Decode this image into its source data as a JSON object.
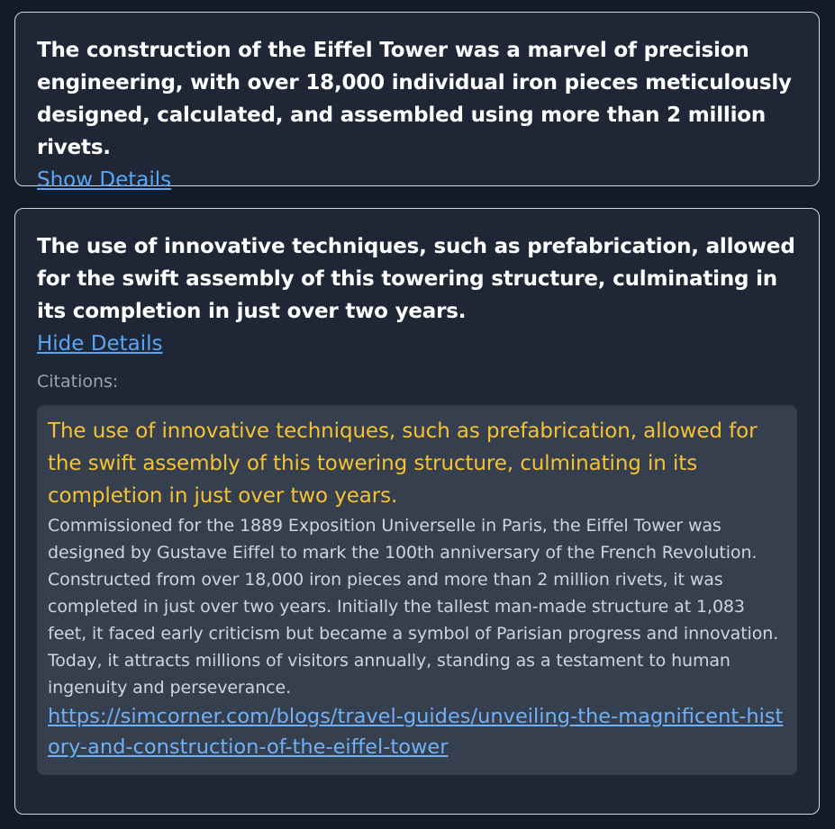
{
  "cards": [
    {
      "claim": "The construction of the Eiffel Tower was a marvel of precision engineering, with over 18,000 individual iron pieces meticulously designed, calculated, and assembled using more than 2 million rivets.",
      "toggle_label": "Show Details",
      "expanded": false
    },
    {
      "claim": "The use of innovative techniques, such as prefabrication, allowed for the swift assembly of this towering structure, culminating in its completion in just over two years.",
      "toggle_label": "Hide Details",
      "expanded": true,
      "citations_label": "Citations:",
      "citation": {
        "quote": "The use of innovative techniques, such as prefabrication, allowed for the swift assembly of this towering structure, culminating in its completion in just over two years.",
        "source_text": "Commissioned for the 1889 Exposition Universelle in Paris, the Eiffel Tower was designed by Gustave Eiffel to mark the 100th anniversary of the French Revolution. Constructed from over 18,000 iron pieces and more than 2 million rivets, it was completed in just over two years. Initially the tallest man-made structure at 1,083 feet, it faced early criticism but became a symbol of Parisian progress and innovation. Today, it attracts millions of visitors annually, standing as a testament to human ingenuity and perseverance.",
        "url": "https://simcorner.com/blogs/travel-guides/unveiling-the-magnificent-history-and-construction-of-the-eiffel-tower"
      }
    }
  ],
  "colors": {
    "page_background": "#131a2a",
    "card_background": "#1f2736",
    "card_border": "#d3d7de",
    "link": "#5aa6f4",
    "citation_highlight": "#f5c233",
    "citation_box": "#363f4e"
  }
}
